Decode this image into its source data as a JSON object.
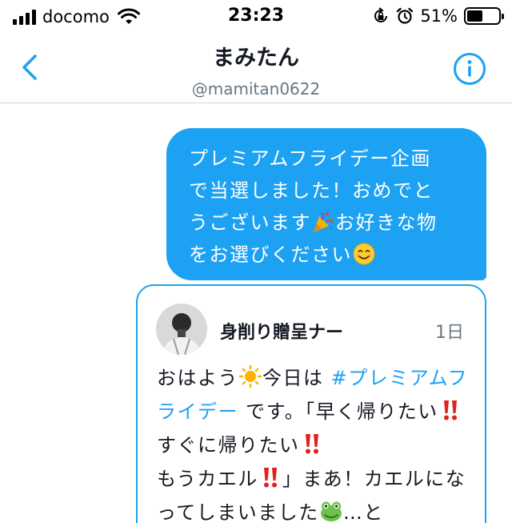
{
  "status_bar": {
    "carrier": "docomo",
    "time": "23:23",
    "battery_percent": "51%",
    "battery_level": 0.51
  },
  "header": {
    "name": "まみたん",
    "handle": "@mamitan0622",
    "back_icon": "chevron-left-icon",
    "info_icon": "info-circle-icon"
  },
  "message": {
    "line1": "プレミアムフライデー企画",
    "line2": "で当選しました！おめでと",
    "line3a": "うございます",
    "line3b": "お好きな物",
    "line4": "をお選びください",
    "emoji1": "party-popper-emoji",
    "emoji2": "smiling-face-emoji"
  },
  "tweet": {
    "author": "身削り贈呈ナー",
    "time": "1日",
    "t1a": "おはよう",
    "t1b": "今日は ",
    "hashtag": "#プレミアムフライデー",
    "t2": " です。「早く帰りたい",
    "t3": "すぐに帰りたい",
    "t4a": "もうカエル",
    "t4b": "」まあ！カエルになってしまいました",
    "t5": "…と",
    "sun_emoji": "sun-emoji",
    "exclaim_emoji": "double-exclamation-emoji",
    "frog_emoji": "frog-emoji"
  },
  "colors": {
    "accent": "#1da1f2",
    "text": "#141823",
    "secondary": "#657786"
  }
}
